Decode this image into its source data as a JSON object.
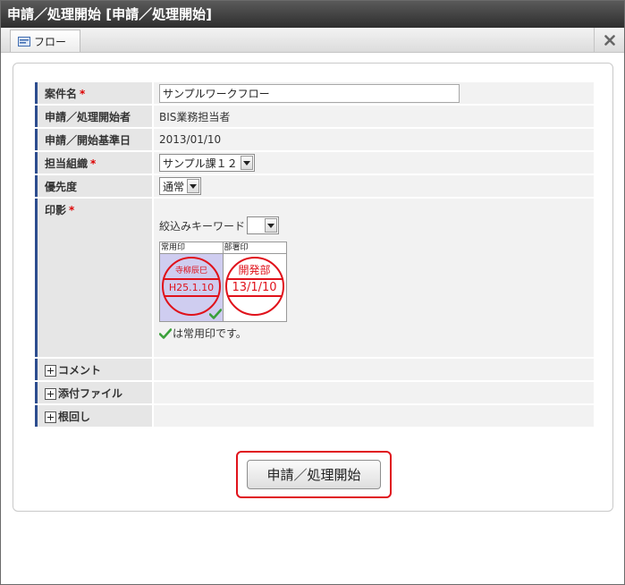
{
  "window": {
    "title": "申請／処理開始 [申請／処理開始]"
  },
  "tabs": [
    {
      "label": "フロー",
      "icon": "flow-icon"
    }
  ],
  "close_icon": "close-icon",
  "form": {
    "matter_name": {
      "label": "案件名",
      "required": "*",
      "value": "サンプルワークフロー"
    },
    "applicant": {
      "label": "申請／処理開始者",
      "value": "BIS業務担当者"
    },
    "base_date": {
      "label": "申請／開始基準日",
      "value": "2013/01/10"
    },
    "organization": {
      "label": "担当組織",
      "required": "*",
      "selected": "サンプル課１２"
    },
    "priority": {
      "label": "優先度",
      "selected": "通常"
    },
    "seal": {
      "label": "印影",
      "required": "*",
      "keyword_label": "絞込みキーワード",
      "keyword_selected": "",
      "options": [
        {
          "header": "常用印",
          "top": "寺柳辰巳",
          "bottom": "H25.1.10",
          "selected": true
        },
        {
          "header": "部署印",
          "top": "開発部",
          "bottom": "13/1/10",
          "selected": false
        }
      ],
      "note": "は常用印です。"
    },
    "sections": [
      {
        "label": "コメント"
      },
      {
        "label": "添付ファイル"
      },
      {
        "label": "根回し"
      }
    ]
  },
  "submit_label": "申請／処理開始",
  "colors": {
    "accent_border": "#2d4d8f",
    "seal_red": "#e0121b",
    "highlight_frame": "#e0121b",
    "selected_seal_bg": "#cfcdf0"
  }
}
